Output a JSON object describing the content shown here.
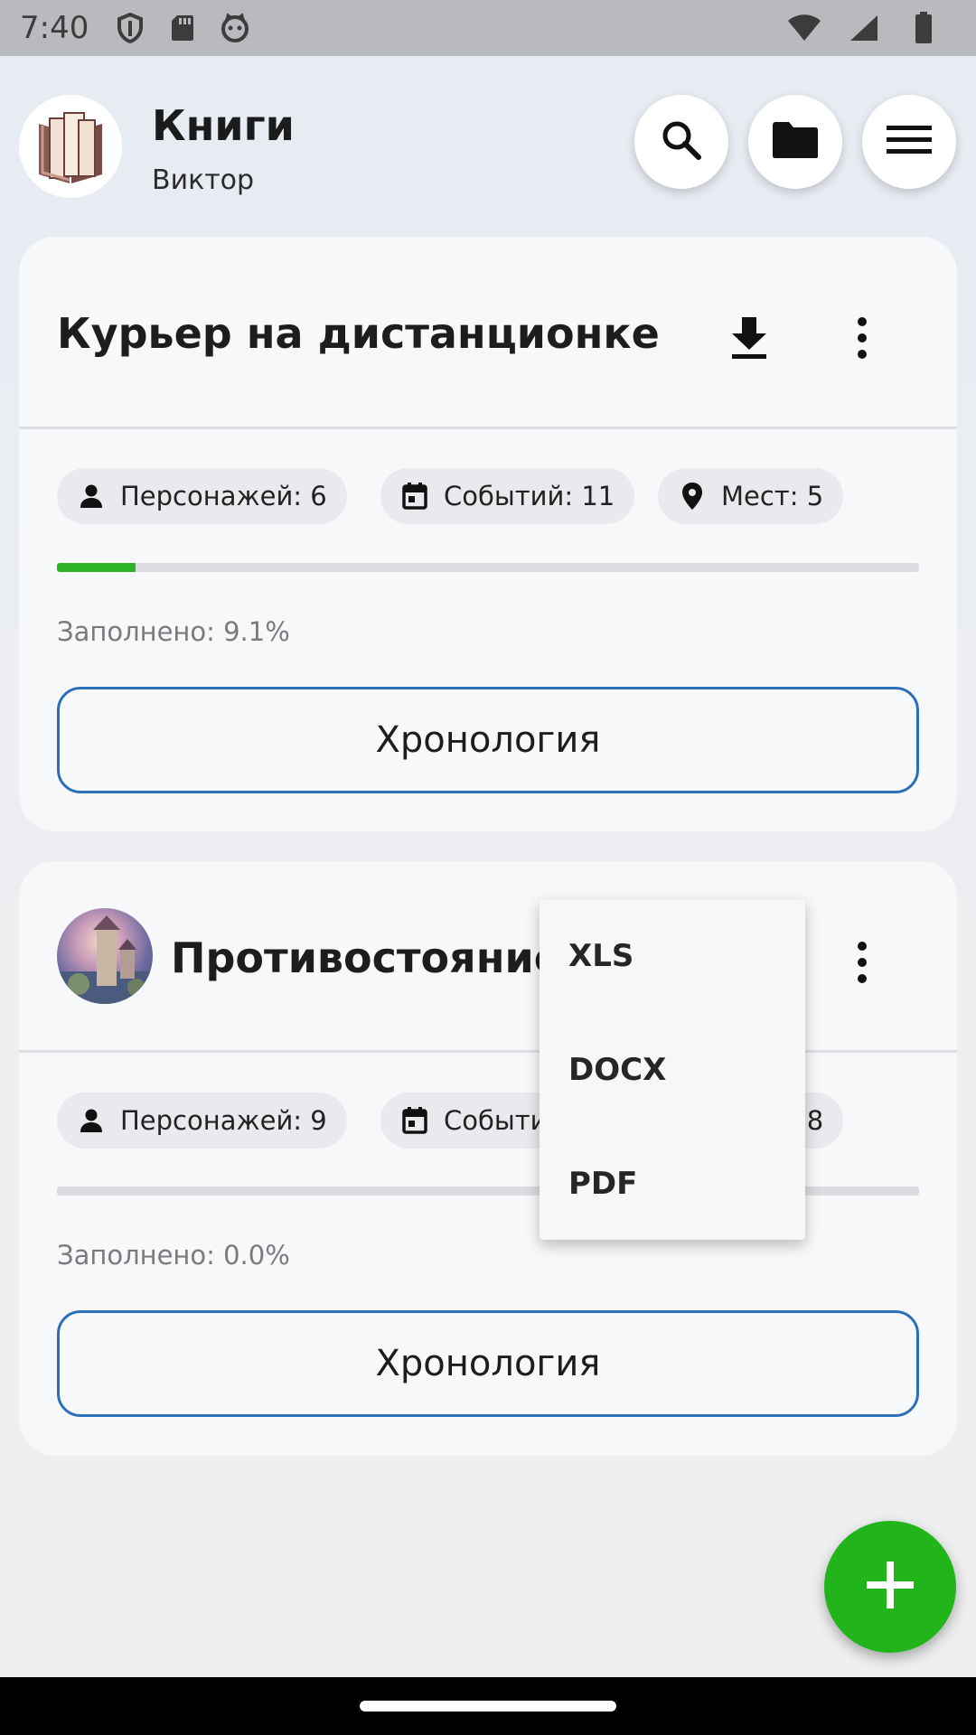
{
  "status_bar": {
    "time": "7:40",
    "icons": [
      "shield-icon",
      "sd-card-icon",
      "cat-icon",
      "wifi-icon",
      "signal-icon",
      "battery-icon"
    ]
  },
  "header": {
    "title": "Книги",
    "subtitle": "Виктор",
    "buttons": [
      "search-icon",
      "folder-icon",
      "menu-icon"
    ]
  },
  "books": [
    {
      "title": "Курьер на дистанционке",
      "characters": "Персонажей: 6",
      "events": "Событий: 11",
      "places": "Мест: 5",
      "progress": 0.091,
      "filled_label": "Заполнено: 9.1%",
      "timeline_label": "Хронология"
    },
    {
      "title": "Противостояние ре...",
      "characters": "Персонажей: 9",
      "events": "Событий: 8",
      "places": "Мест: 8",
      "progress": 0.0,
      "filled_label": "Заполнено: 0.0%",
      "timeline_label": "Хронология"
    }
  ],
  "export_menu": {
    "items": [
      "XLS",
      "DOCX",
      "PDF"
    ]
  },
  "colors": {
    "accent_green": "#22b41b",
    "outline_blue": "#2a6fb7",
    "progress_green": "#2db52a"
  }
}
